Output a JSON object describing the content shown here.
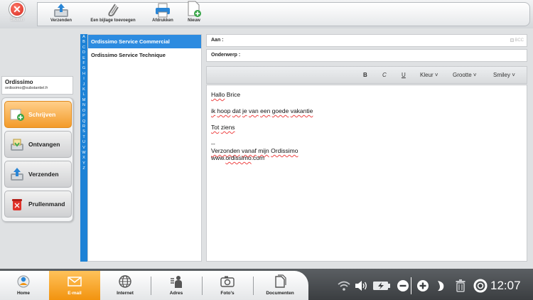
{
  "toolbar": {
    "close_label": "Sluiten",
    "send_label": "Verzenden",
    "attach_label": "Een bijlage toevoegen",
    "print_label": "Afdrukken",
    "new_label": "Nieuw"
  },
  "user": {
    "name": "Ordissimo",
    "email": "ordissimo@substantiel.fr"
  },
  "nav": {
    "write": "Schrijven",
    "receive": "Ontvangen",
    "send": "Verzenden",
    "trash": "Prullenmand"
  },
  "alphabet": [
    "A",
    "B",
    "C",
    "D",
    "E",
    "F",
    "G",
    "H",
    "I",
    "J",
    "K",
    "L",
    "M",
    "N",
    "O",
    "P",
    "Q",
    "R",
    "S",
    "T",
    "U",
    "V",
    "W",
    "X",
    "Y",
    "Z"
  ],
  "contacts": [
    "Ordissimo Service Commercial",
    "Ordissimo Service Technique"
  ],
  "compose": {
    "to_label": "Aan :",
    "bcc_label": "BCC",
    "subject_label": "Onderwerp :",
    "format": {
      "bold": "B",
      "italic": "C",
      "underline": "U",
      "color": "Kleur",
      "size": "Grootte",
      "smiley": "Smiley"
    },
    "body": {
      "greeting_w1": "Hallo",
      "greeting_w2": " Brice",
      "l2_w1": "ik",
      "l2_w2": "hoop",
      "l2_w3": "dat",
      "l2_w4": "je",
      "l2_w5": "van",
      "l2_w6": "een",
      "l2_w7": "goede",
      "l2_w8": "vakantie",
      "l3_w1": "Tot",
      "l3_w2": "ziens",
      "sig_dash": "--",
      "sig_w1": "Verzonden",
      "sig_w2": "vanaf",
      "sig_w3": "mijn",
      "sig_w4": "Ordissimo",
      "url_pre": "www.",
      "url_mid": "ordissimo",
      "url_post": ".com"
    }
  },
  "taskbar": {
    "home": "Home",
    "email": "E-mail",
    "internet": "Internet",
    "address": "Adres",
    "photos": "Foto's",
    "documents": "Documenten"
  },
  "clock": "12:07",
  "colors": {
    "accent_orange": "#f2930f",
    "selection_blue": "#2c8be0",
    "alphabet_blue": "#1d82d6",
    "close_red": "#d4261b"
  },
  "icons": [
    "close-icon",
    "send-tray-icon",
    "paperclip-icon",
    "printer-icon",
    "new-document-icon",
    "write-icon",
    "receive-tray-icon",
    "send-icon",
    "trash-icon",
    "home-icon",
    "email-icon",
    "globe-icon",
    "address-icon",
    "camera-icon",
    "documents-icon",
    "wifi-icon",
    "volume-icon",
    "battery-icon",
    "minus-circle-icon",
    "plus-circle-icon",
    "moon-icon",
    "trash-tray-icon",
    "help-lifebuoy-icon"
  ]
}
